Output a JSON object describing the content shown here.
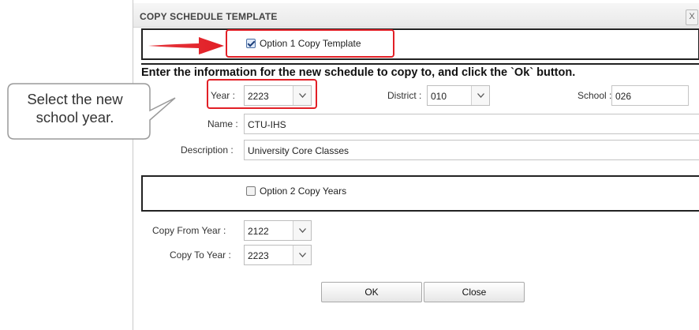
{
  "dialog": {
    "title": "COPY SCHEDULE TEMPLATE",
    "close_label": "X"
  },
  "option1": {
    "label": "Option 1 Copy Template",
    "checked": true
  },
  "instruction": "Enter the information for the new schedule to copy to, and click the `Ok` button.",
  "fields": {
    "year": {
      "label": "Year :",
      "value": "2223"
    },
    "district": {
      "label": "District :",
      "value": "010"
    },
    "school": {
      "label": "School :",
      "value": "026"
    },
    "name": {
      "label": "Name :",
      "value": "CTU-IHS"
    },
    "description": {
      "label": "Description :",
      "value": "University Core Classes"
    }
  },
  "option2": {
    "label": "Option 2 Copy Years",
    "checked": false
  },
  "copy_years": {
    "from": {
      "label": "Copy From Year :",
      "value": "2122"
    },
    "to": {
      "label": "Copy To Year :",
      "value": "2223"
    }
  },
  "buttons": {
    "ok": "OK",
    "close": "Close"
  },
  "annotation": {
    "callout_text": "Select the new school year.",
    "highlight_color": "#e21f26"
  }
}
